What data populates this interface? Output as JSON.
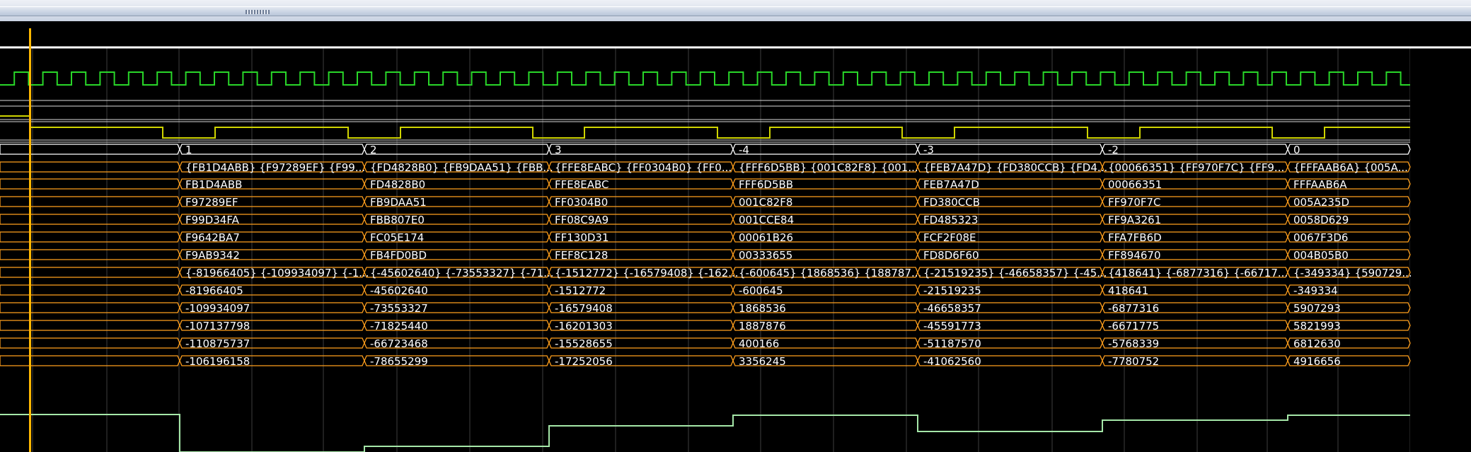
{
  "scrollbar": {
    "thumb_icon": "grip-icon"
  },
  "colors": {
    "grid": "#3e3e3e",
    "bus": "#ff9f1c",
    "clock": "#29d629",
    "cursor": "#ffb700",
    "analog": "#a5e7a8",
    "text": "#ffffff",
    "divider": "#ffffff"
  },
  "waveform": {
    "segments": [
      {
        "seg": "1",
        "row": "{FB1D4ABB} {F97289EF} {F99...",
        "hex": [
          "FB1D4ABB",
          "F97289EF",
          "F99D34FA",
          "F9642BA7",
          "F9AB9342"
        ],
        "dec_row": "{-81966405} {-109934097} {-1...",
        "dec": [
          "-81966405",
          "-109934097",
          "-107137798",
          "-110875737",
          "-106196158"
        ]
      },
      {
        "seg": "2",
        "row": "{FD4828B0} {FB9DAA51} {FBB...",
        "hex": [
          "FD4828B0",
          "FB9DAA51",
          "FBB807E0",
          "FC05E174",
          "FB4FD0BD"
        ],
        "dec_row": "{-45602640} {-73553327} {-71...",
        "dec": [
          "-45602640",
          "-73553327",
          "-71825440",
          "-66723468",
          "-78655299"
        ]
      },
      {
        "seg": "3",
        "row": "{FFE8EABC} {FF0304B0} {FF0...",
        "hex": [
          "FFE8EABC",
          "FF0304B0",
          "FF08C9A9",
          "FF130D31",
          "FEF8C128"
        ],
        "dec_row": "{-1512772} {-16579408} {-162...",
        "dec": [
          "-1512772",
          "-16579408",
          "-16201303",
          "-15528655",
          "-17252056"
        ]
      },
      {
        "seg": "-4",
        "row": "{FFF6D5BB} {001C82F8} {001...",
        "hex": [
          "FFF6D5BB",
          "001C82F8",
          "001CCE84",
          "00061B26",
          "00333655"
        ],
        "dec_row": "{-600645} {1868536} {188787...",
        "dec": [
          "-600645",
          "1868536",
          "1887876",
          "400166",
          "3356245"
        ]
      },
      {
        "seg": "-3",
        "row": "{FEB7A47D} {FD380CCB} {FD4...",
        "hex": [
          "FEB7A47D",
          "FD380CCB",
          "FD485323",
          "FCF2F08E",
          "FD8D6F60"
        ],
        "dec_row": "{-21519235} {-46658357} {-45...",
        "dec": [
          "-21519235",
          "-46658357",
          "-45591773",
          "-51187570",
          "-41062560"
        ]
      },
      {
        "seg": "-2",
        "row": "{00066351} {FF970F7C} {FF9...",
        "hex": [
          "00066351",
          "FF970F7C",
          "FF9A3261",
          "FFA7FB6D",
          "FF894670"
        ],
        "dec_row": "{418641} {-6877316} {-66717...",
        "dec": [
          "418641",
          "-6877316",
          "-6671775",
          "-5768339",
          "-7780752"
        ]
      },
      {
        "seg": "0",
        "row": "{FFFAAB6A} {005A...",
        "hex": [
          "FFFAAB6A",
          "005A235D",
          "0058D629",
          "0067F3D6",
          "004B05B0"
        ],
        "dec_row": "{-349334} {590729...",
        "dec": [
          "-349334",
          "5907293",
          "5821993",
          "6812630",
          "4916656"
        ]
      }
    ]
  }
}
